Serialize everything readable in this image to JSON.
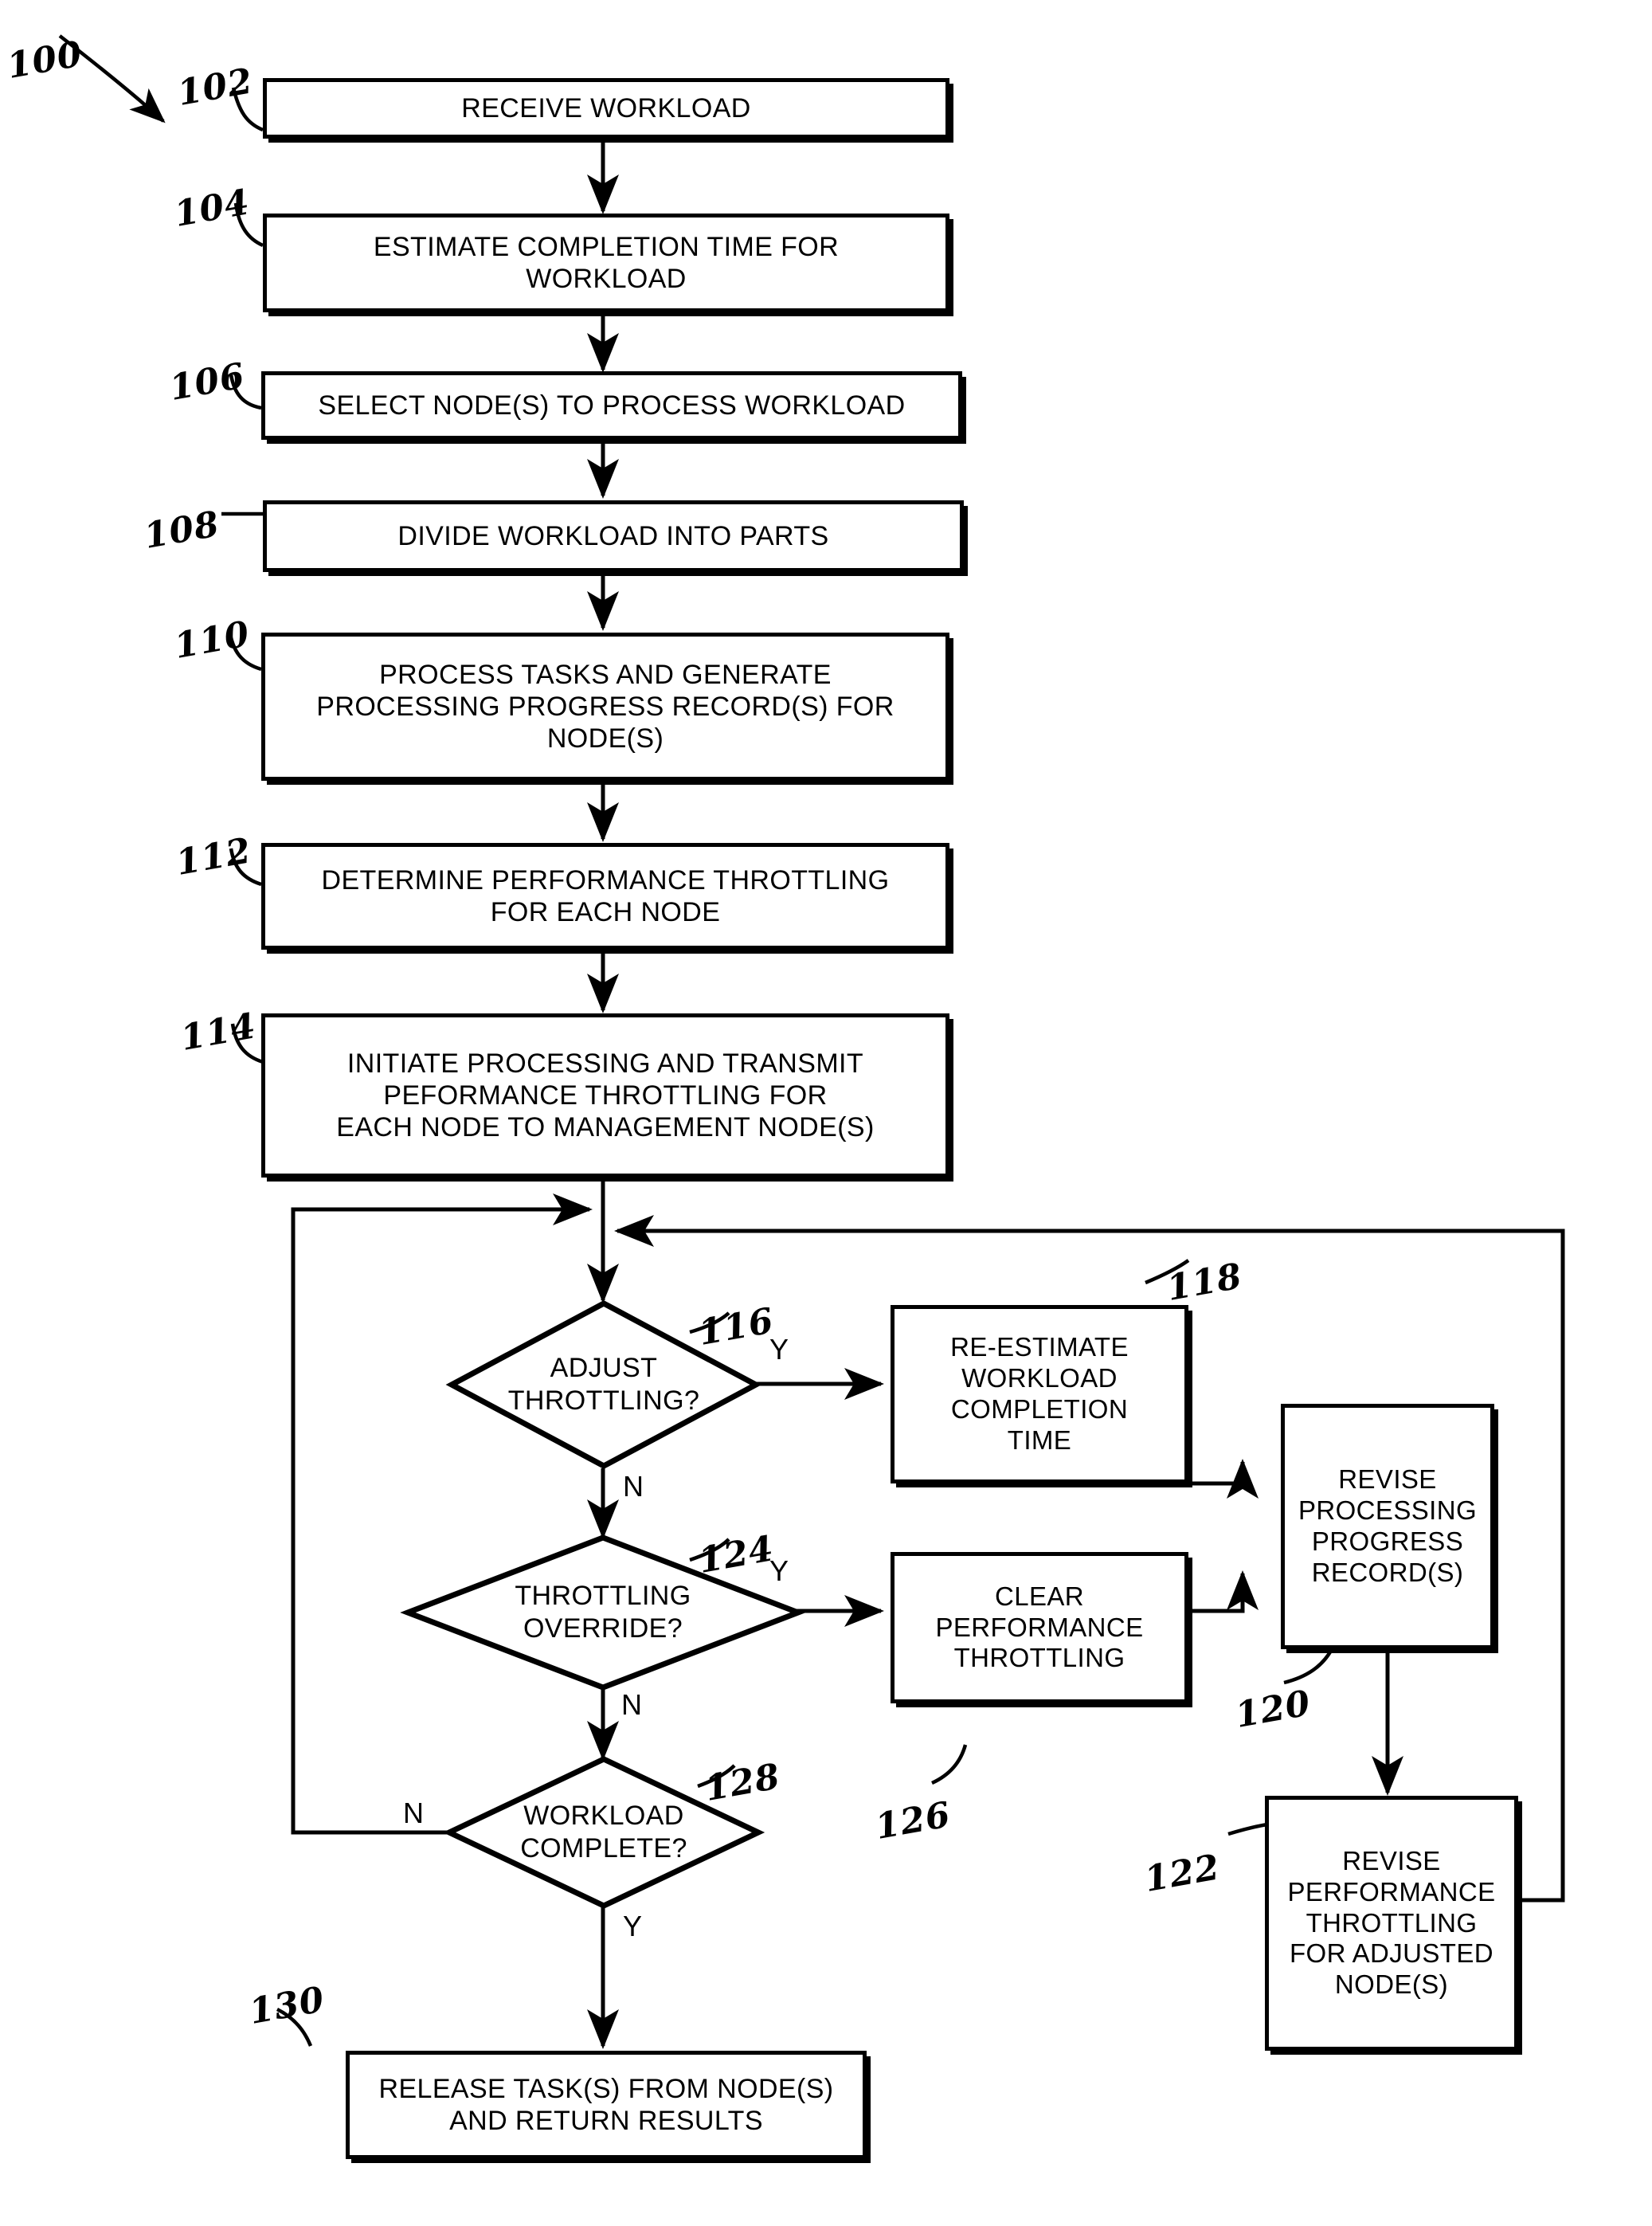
{
  "figure": {
    "id": "100",
    "title": "Workload Performance Throttling Process Flowchart"
  },
  "nodes": {
    "n102": {
      "ref": "102",
      "text": "RECEIVE WORKLOAD"
    },
    "n104": {
      "ref": "104",
      "text": "ESTIMATE COMPLETION TIME FOR\nWORKLOAD"
    },
    "n106": {
      "ref": "106",
      "text": "SELECT NODE(S) TO PROCESS WORKLOAD"
    },
    "n108": {
      "ref": "108",
      "text": "DIVIDE WORKLOAD INTO PARTS"
    },
    "n110": {
      "ref": "110",
      "text": "PROCESS TASKS AND GENERATE\nPROCESSING PROGRESS RECORD(S) FOR\nNODE(S)"
    },
    "n112": {
      "ref": "112",
      "text": "DETERMINE PERFORMANCE THROTTLING\nFOR EACH NODE"
    },
    "n114": {
      "ref": "114",
      "text": "INITIATE PROCESSING AND TRANSMIT\nPEFORMANCE THROTTLING FOR\nEACH NODE TO MANAGEMENT NODE(S)"
    },
    "n116": {
      "ref": "116",
      "text": "ADJUST\nTHROTTLING?"
    },
    "n118": {
      "ref": "118",
      "text": "RE-ESTIMATE\nWORKLOAD\nCOMPLETION\nTIME"
    },
    "n120": {
      "ref": "120",
      "text": "REVISE\nPROCESSING\nPROGRESS\nRECORD(S)"
    },
    "n122": {
      "ref": "122",
      "text": "REVISE\nPERFORMANCE\nTHROTTLING\nFOR ADJUSTED\nNODE(S)"
    },
    "n124": {
      "ref": "124",
      "text": "THROTTLING\nOVERRIDE?"
    },
    "n126": {
      "ref": "126",
      "text": "CLEAR\nPERFORMANCE\nTHROTTLING"
    },
    "n128": {
      "ref": "128",
      "text": "WORKLOAD\nCOMPLETE?"
    },
    "n130": {
      "ref": "130",
      "text": "RELEASE TASK(S) FROM NODE(S)\nAND RETURN RESULTS"
    }
  },
  "branches": {
    "b116_yes": "Y",
    "b116_no": "N",
    "b124_yes": "Y",
    "b124_no": "N",
    "b128_no": "N",
    "b128_yes": "Y"
  },
  "colors": {
    "stroke": "#000000",
    "background": "#ffffff"
  }
}
